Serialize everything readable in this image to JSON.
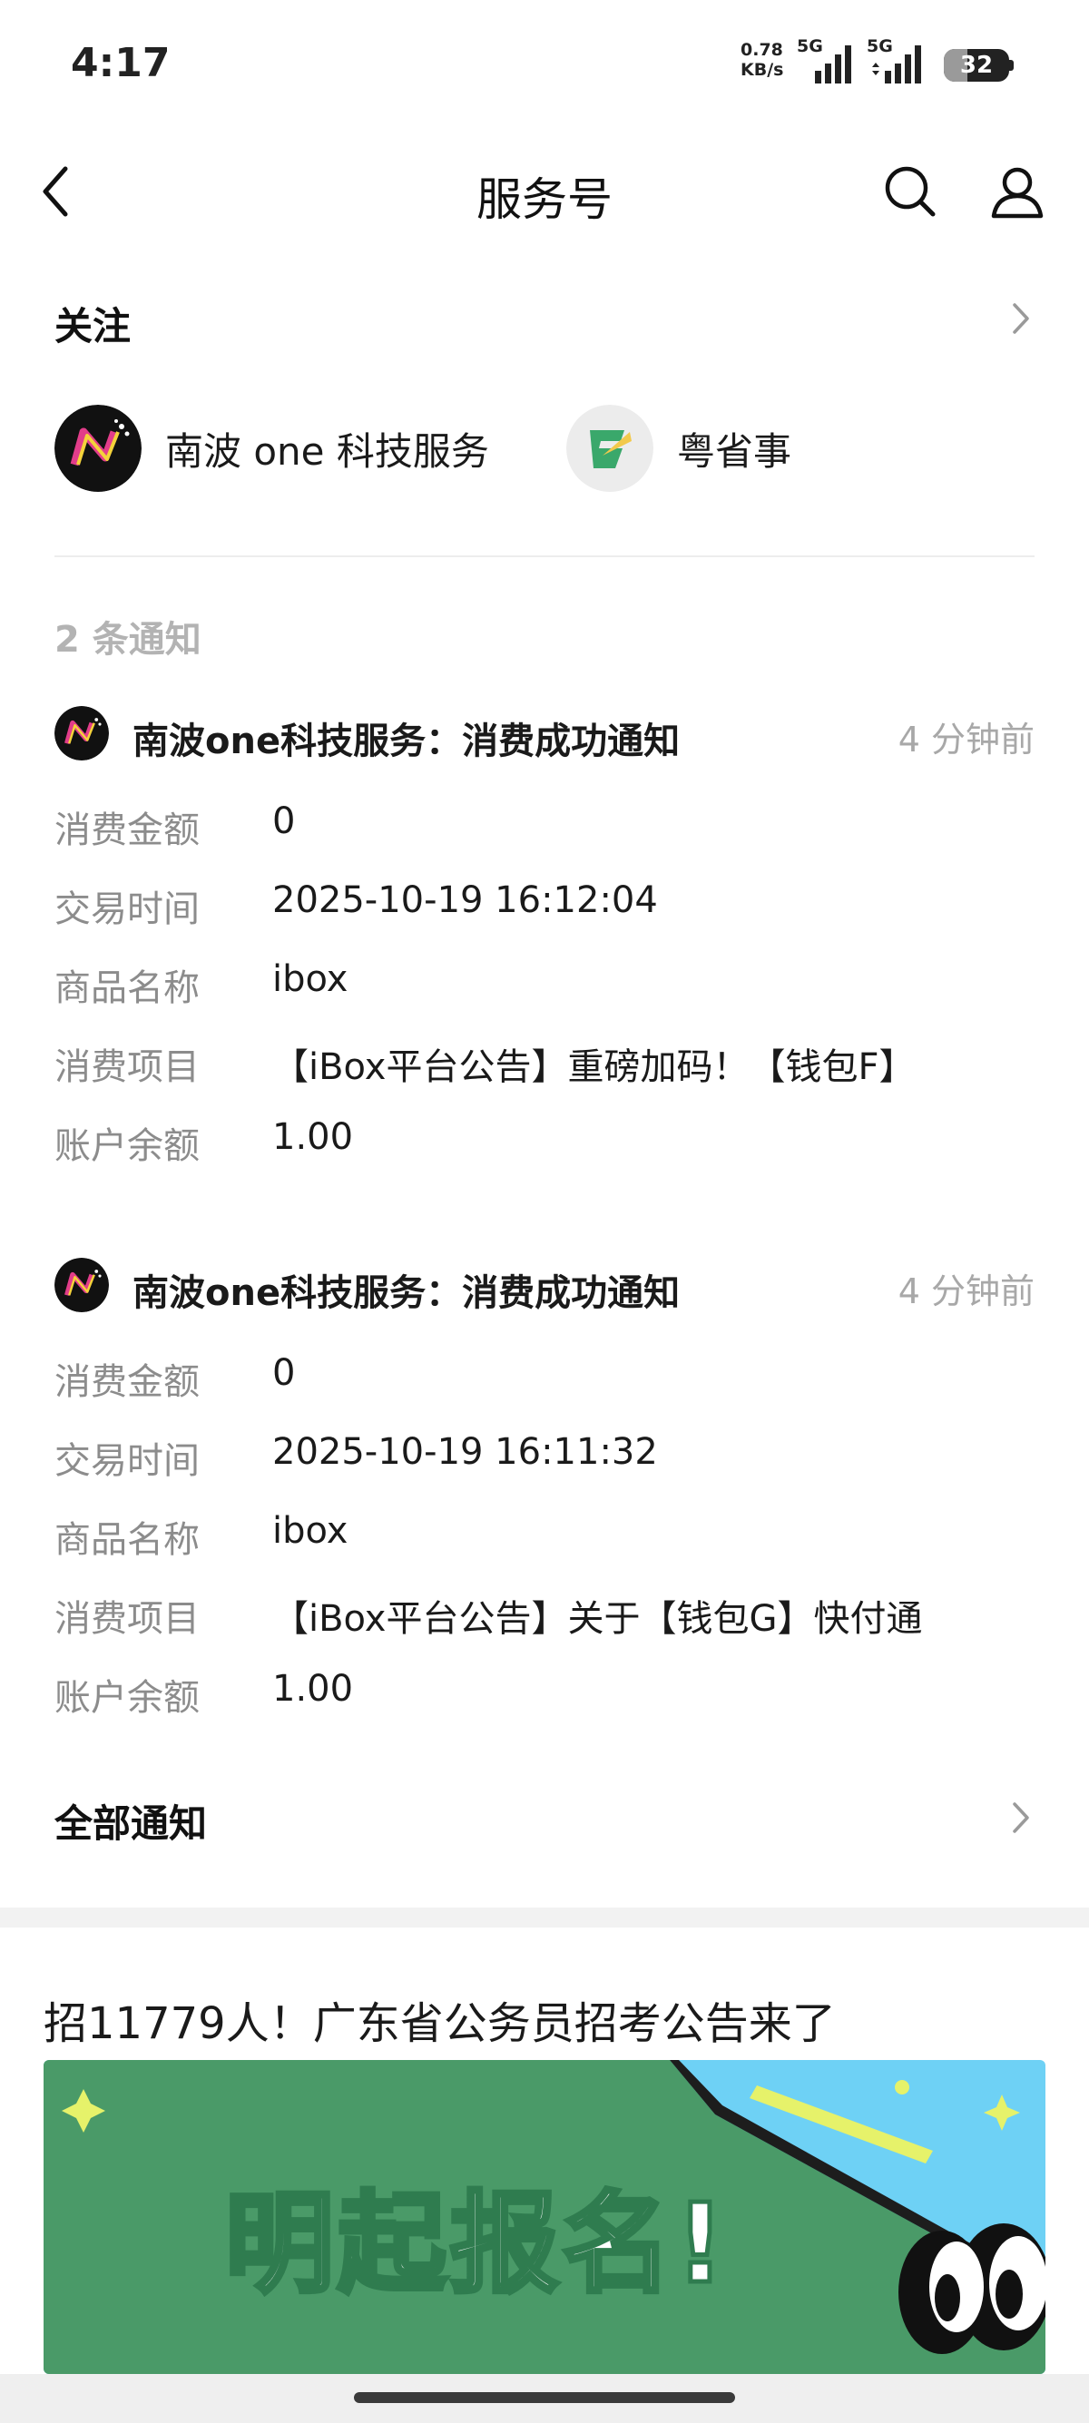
{
  "status_bar": {
    "time": "4:17",
    "net_speed_value": "0.78",
    "net_speed_unit": "KB/s",
    "sim1_tag": "5G",
    "sim2_tag": "5G",
    "battery_level": "32"
  },
  "nav": {
    "title": "服务号",
    "back_icon": "chevron-left-icon",
    "search_icon": "search-icon",
    "profile_icon": "user-icon"
  },
  "follow": {
    "title": "关注",
    "accounts": [
      {
        "name": "南波 one 科技服务",
        "avatar": "nanbo-logo"
      },
      {
        "name": "粤省事",
        "avatar": "yueshengshi-logo"
      }
    ]
  },
  "notices": {
    "count_label": "2 条通知",
    "items": [
      {
        "title": "南波one科技服务：消费成功通知",
        "time": "4 分钟前",
        "rows": [
          {
            "key": "消费金额",
            "value": "0"
          },
          {
            "key": "交易时间",
            "value": "2025-10-19 16:12:04"
          },
          {
            "key": "商品名称",
            "value": "ibox"
          },
          {
            "key": "消费项目",
            "value": "【iBox平台公告】重磅加码！【钱包F】"
          },
          {
            "key": "账户余额",
            "value": "1.00"
          }
        ]
      },
      {
        "title": "南波one科技服务：消费成功通知",
        "time": "4 分钟前",
        "rows": [
          {
            "key": "消费金额",
            "value": "0"
          },
          {
            "key": "交易时间",
            "value": "2025-10-19 16:11:32"
          },
          {
            "key": "商品名称",
            "value": "ibox"
          },
          {
            "key": "消费项目",
            "value": "【iBox平台公告】关于【钱包G】快付通"
          },
          {
            "key": "账户余额",
            "value": "1.00"
          }
        ]
      }
    ],
    "all_label": "全部通知"
  },
  "article": {
    "title": "招11779人！广东省公务员招考公告来了",
    "banner_text": "明起报名!",
    "colors": {
      "sky": "#6ed1f5",
      "board": "#4a9a68",
      "star": "#e6f26a"
    }
  }
}
